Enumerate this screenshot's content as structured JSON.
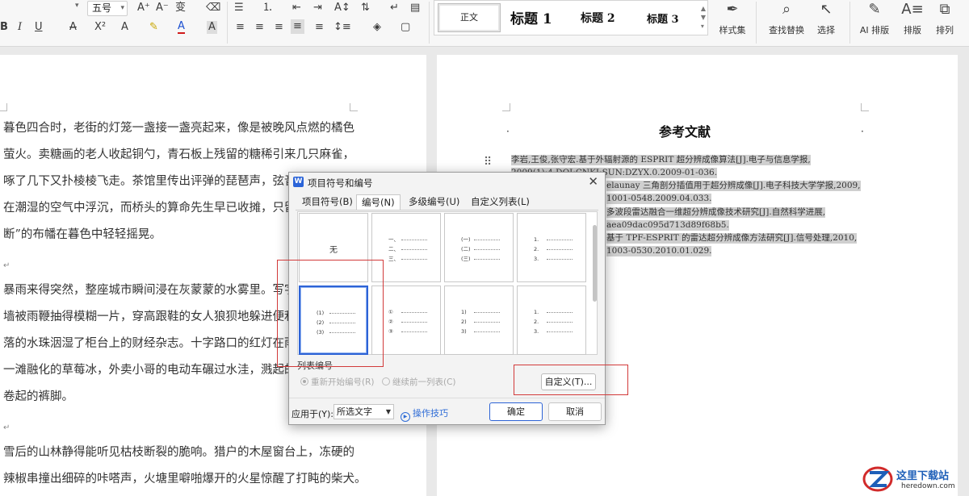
{
  "ribbon": {
    "font_size_value": "五号",
    "styles": {
      "normal": "正文",
      "h1": "标题 1",
      "h2": "标题 2",
      "h3": "标题 3"
    },
    "style_set_label": "样式集",
    "find_replace_label": "查找替换",
    "select_label": "选择",
    "ai_layout_label": "AI 排版",
    "layout_label": "排版",
    "arrange_label": "排列"
  },
  "document_left": {
    "paragraphs": [
      [
        "暮色四合时，老街的灯笼一盏接一盏亮起来，像是被晚风点燃的橘色",
        "萤火。卖糖画的老人收起铜勺，青石板上残留的糖稀引来几只麻雀，",
        "啄了几下又扑棱棱飞走。茶馆里传出评弹的琵琶声，弦音",
        "在潮湿的空气中浮沉，而桥头的算命先生早已收摊，只留",
        "断”的布幡在暮色中轻轻摇晃。"
      ],
      [
        "暴雨来得突然，整座城市瞬间浸在灰蒙蒙的水雾里。写字",
        "墙被雨鞭抽得模糊一片，穿高跟鞋的女人狼狈地躲进便利",
        "落的水珠洇湿了柜台上的财经杂志。十字路口的红灯在雨",
        "一滩融化的草莓冰，外卖小哥的电动车碾过水洼，溅起的",
        "卷起的裤脚。"
      ],
      [
        "雪后的山林静得能听见枯枝断裂的脆响。猎户的木屋窗台上，冻硬的",
        "辣椒串撞出细碎的咔嗒声，火塘里噼啪爆开的火星惊醒了打盹的柴犬。"
      ]
    ]
  },
  "document_right": {
    "title": "参考文献",
    "references": [
      "李岩,王俊,张守宏.基于外辐射源的 ESPRIT 超分辨成像算法[J].电子与信息学报,",
      "2009(1):4.DOI:CNKI:SUN:DZYX.0.2009-01-036.",
      "elaunay 三角剖分插值用于超分辨成像[J].电子科技大学学报,2009,",
      "1001-0548.2009.04.033.",
      "多波段雷达融合一维超分辨成像技术研究[J].自然科学进展,",
      "aea09dac095d713d89f68b5.",
      "基于 TPF-ESPRIT 的雷达超分辨成像方法研究[J].信号处理,2010,",
      "1003-0530.2010.01.029."
    ]
  },
  "dialog": {
    "title": "项目符号和编号",
    "tabs": [
      "项目符号(B)",
      "编号(N)",
      "多级编号(U)",
      "自定义列表(L)"
    ],
    "active_tab": "编号(N)",
    "gallery": {
      "none_label": "无",
      "cells": [
        {
          "kind": "none"
        },
        {
          "kind": "list",
          "labels": [
            "一、",
            "二、",
            "三、"
          ]
        },
        {
          "kind": "list",
          "labels": [
            "(一)",
            "(二)",
            "(三)"
          ]
        },
        {
          "kind": "list",
          "labels": [
            "1.",
            "2.",
            "3."
          ]
        },
        {
          "kind": "list",
          "labels": [
            "(1)",
            "(2)",
            "(3)"
          ],
          "selected": true
        },
        {
          "kind": "list",
          "labels": [
            "①",
            "②",
            "③"
          ]
        },
        {
          "kind": "list",
          "labels": [
            "1)",
            "2)",
            "3)"
          ]
        },
        {
          "kind": "list",
          "labels": [
            "1.",
            "2.",
            "3."
          ]
        }
      ]
    },
    "list_numbering_label": "列表编号",
    "radio_restart": "重新开始编号(R)",
    "radio_continue": "继续前一列表(C)",
    "custom_button": "自定义(T)...",
    "apply_to_label": "应用于(Y):",
    "apply_to_value": "所选文字",
    "tips_link": "操作技巧",
    "ok_button": "确定",
    "cancel_button": "取消"
  },
  "watermark": {
    "title": "这里下载站",
    "url": "heredown.com"
  },
  "colors": {
    "accent": "#2d63d6",
    "annotation": "#d23a3a",
    "selection": "#cfcfcf"
  }
}
